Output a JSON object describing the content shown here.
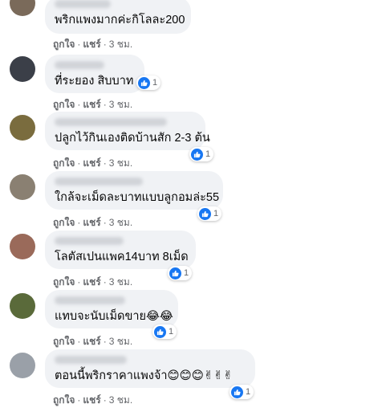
{
  "comments": [
    {
      "text": "พริกแพงมากค่ะกิโลละ200",
      "likes": "",
      "avatar_color": "#7a6a5a"
    },
    {
      "text": "ที่ระยอง สิบบาท",
      "likes": "1",
      "avatar_color": "#3b3f48"
    },
    {
      "text": "ปลูกไว้กินเองติดบ้านสัก 2-3 ต้น",
      "likes": "1",
      "avatar_color": "#7a6c3e"
    },
    {
      "text": "ใกล้จะเม็ดละบาทแบบลูกอมล่ะ55",
      "likes": "1",
      "avatar_color": "#8a8072"
    },
    {
      "text": "โลตัสเปนแพค14บาท 8เม็ด",
      "likes": "1",
      "avatar_color": "#9a6a5a"
    },
    {
      "text": "แทบจะนับเม็ดขาย😂😂",
      "likes": "1",
      "avatar_color": "#5a6a3a"
    },
    {
      "text": "ตอนนี้พริกราคาแพงจ้า😊😊😊✌✌✌",
      "likes": "1",
      "avatar_color": "#9aa0a8"
    }
  ],
  "actions": {
    "like": "ถูกใจ",
    "share": "แชร์",
    "dot": "·",
    "time": "3 ชม."
  },
  "colors": {
    "bubble": "#f0f2f5",
    "like_blue": "#1877f2",
    "meta_gray": "#65676b"
  },
  "icons": {
    "like": "thumbs-up-icon"
  }
}
